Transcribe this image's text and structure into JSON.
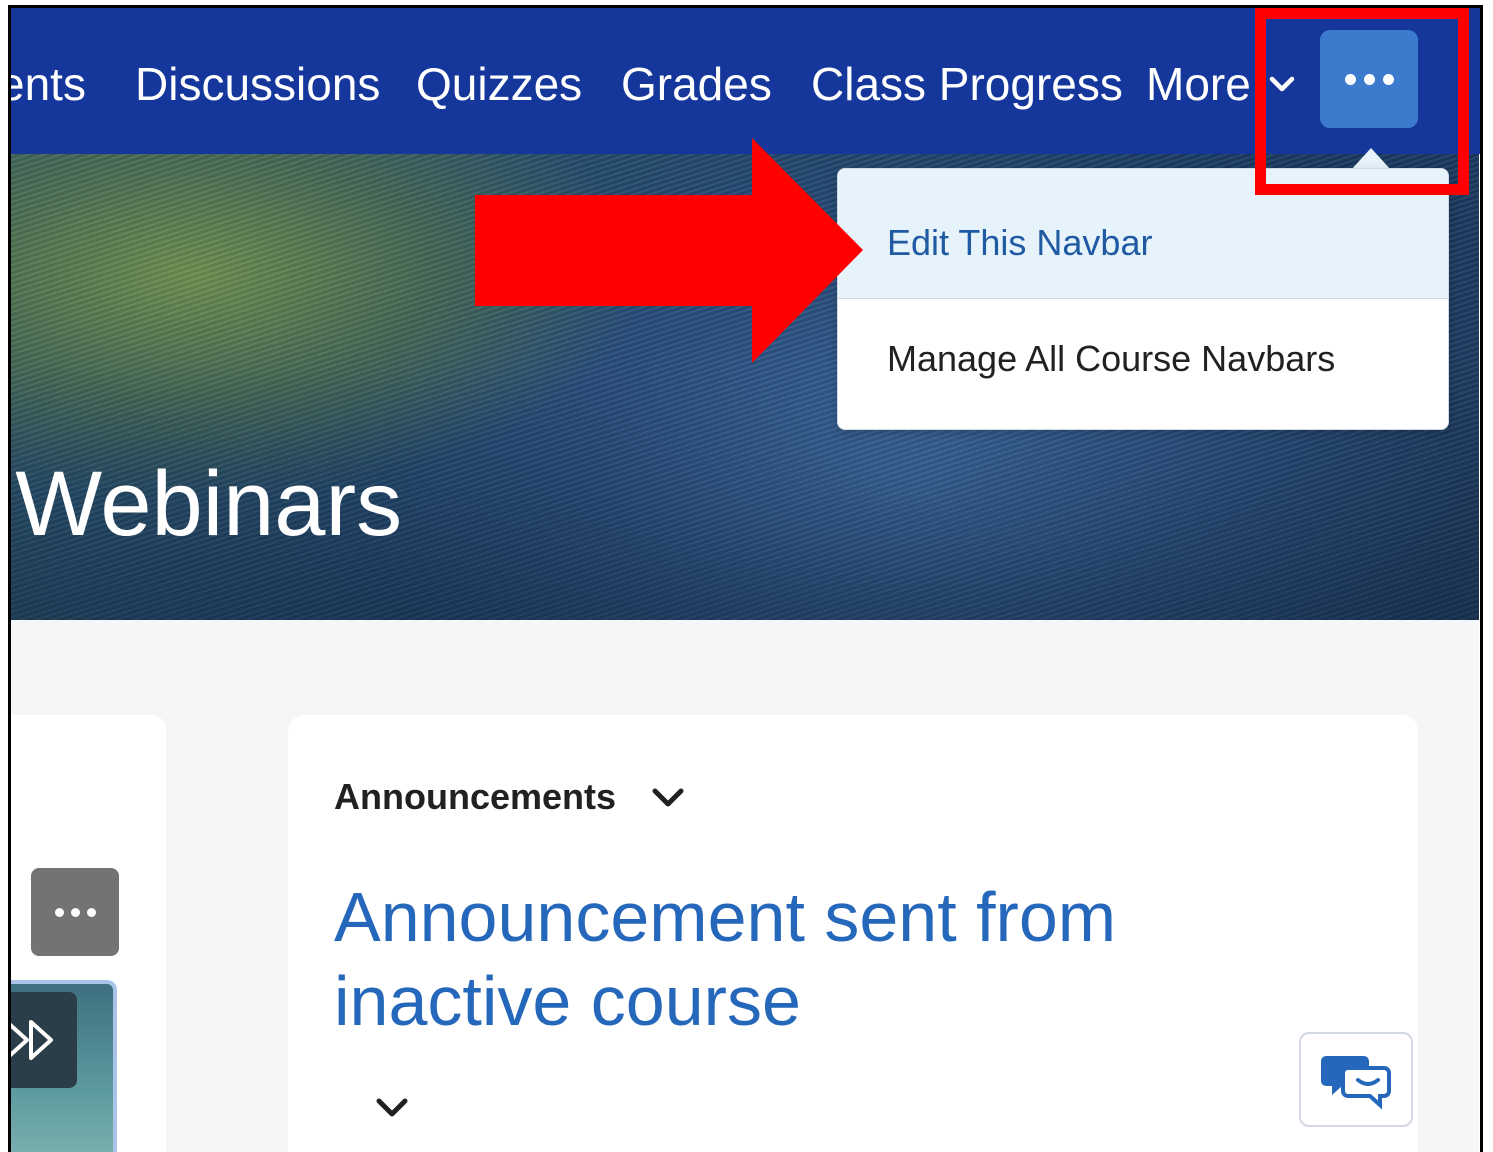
{
  "navbar": {
    "items": [
      {
        "label": "ents"
      },
      {
        "label": "Discussions"
      },
      {
        "label": "Quizzes"
      },
      {
        "label": "Grades"
      },
      {
        "label": "Class Progress"
      },
      {
        "label": "More"
      }
    ],
    "overflow_icon": "ellipsis-icon",
    "background_color": "#15369b",
    "button_color": "#3c7ace"
  },
  "banner": {
    "title": "r Webinars"
  },
  "dropdown": {
    "items": [
      {
        "label": "Edit This Navbar",
        "state": "highlighted"
      },
      {
        "label": "Manage All Course Navbars"
      }
    ]
  },
  "annotations": {
    "arrow_color": "#ff0000",
    "highlight_box_color": "#ff0000"
  },
  "announcements": {
    "header": "Announcements",
    "title": "Announcement sent from inactive course",
    "feedback_icon": "chat-bubbles-icon"
  },
  "left_widget": {
    "options_icon": "ellipsis-icon",
    "play_icon": "fast-forward-icon"
  },
  "colors": {
    "link": "#2567ba",
    "menu_highlight": "#e7f3fb"
  }
}
